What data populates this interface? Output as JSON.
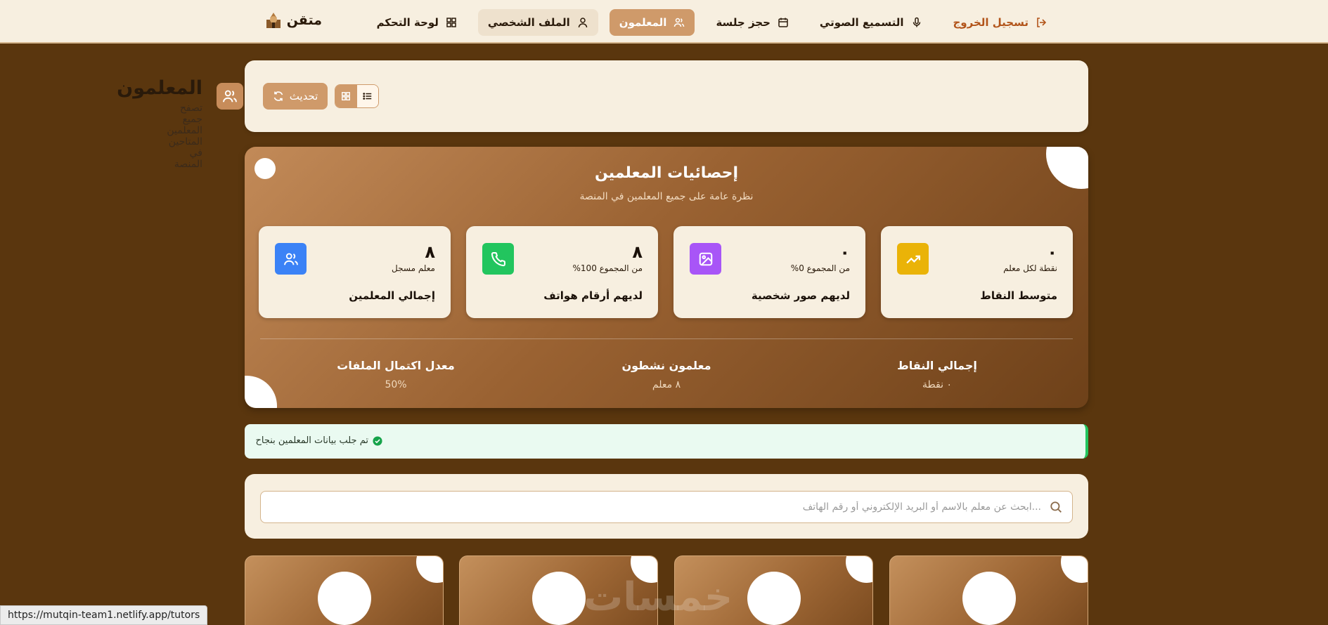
{
  "nav": {
    "brand": "متقن",
    "items": [
      {
        "label": "تسجيل الخروج",
        "icon": "logout-icon"
      },
      {
        "label": "التسميع الصوتي",
        "icon": "microphone-icon"
      },
      {
        "label": "حجز جلسة",
        "icon": "calendar-icon"
      },
      {
        "label": "المعلمون",
        "icon": "users-icon"
      },
      {
        "label": "الملف الشخصي",
        "icon": "user-icon"
      },
      {
        "label": "لوحة التحكم",
        "icon": "grid-icon"
      }
    ]
  },
  "header": {
    "title": "المعلمون",
    "subtitle": "تصفح جميع المعلمين المتاحين في المنصة",
    "refresh_label": "تحديث"
  },
  "stats": {
    "title": "إحصائيات المعلمين",
    "subtitle": "نظرة عامة على جميع المعلمين في المنصة",
    "cards": [
      {
        "value": "٠",
        "unit": "نقطة لكل معلم",
        "label": "متوسط النقاط",
        "color": "#eab308",
        "icon": "trending-up-icon"
      },
      {
        "value": "٠",
        "unit": "من المجموع 0%",
        "label": "لديهم صور شخصية",
        "color": "#a855f7",
        "icon": "image-icon"
      },
      {
        "value": "٨",
        "unit": "من المجموع 100%",
        "label": "لديهم أرقام هواتف",
        "color": "#22c55e",
        "icon": "phone-icon"
      },
      {
        "value": "٨",
        "unit": "معلم مسجل",
        "label": "إجمالي المعلمين",
        "color": "#3b82f6",
        "icon": "users-icon"
      }
    ],
    "summary": [
      {
        "label": "إجمالي النقاط",
        "value": "٠ نقطة"
      },
      {
        "label": "معلمون نشطون",
        "value": "٨ معلم"
      },
      {
        "label": "معدل اكتمال الملفات",
        "value": "50%"
      }
    ]
  },
  "alert": {
    "message": "تم جلب بيانات المعلمين بنجاح"
  },
  "search": {
    "placeholder": "...ابحث عن معلم بالاسم أو البريد الإلكتروني أو رقم الهاتف",
    "value": ""
  },
  "watermark": "خمسات",
  "status_url": "https://mutqin-team1.netlify.app/tutors"
}
